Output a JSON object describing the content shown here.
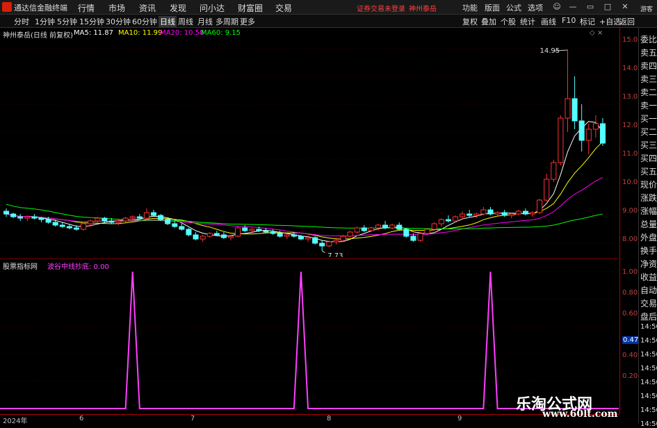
{
  "app": {
    "title": "通达信金融终端"
  },
  "menu": [
    "行情",
    "市场",
    "资讯",
    "发现",
    "问小达",
    "财富圈",
    "交易"
  ],
  "notice": {
    "login": "证券交易未登录",
    "stock": "神州泰岳"
  },
  "top_right": [
    "功能",
    "版面",
    "公式",
    "选项"
  ],
  "periods": [
    "分时",
    "1分钟",
    "5分钟",
    "15分钟",
    "30分钟",
    "60分钟",
    "日线",
    "周线",
    "月线",
    "多周期",
    "更多"
  ],
  "active_period": "日线",
  "tools": [
    "复权",
    "叠加",
    "个股",
    "统计",
    "画线",
    "F10",
    "标记",
    "+自选",
    "返回"
  ],
  "info": {
    "stock_label": "神州泰岳(日线 前复权)",
    "ma5": "MA5: 11.87",
    "ma10": "MA10: 11.99",
    "ma20": "MA20: 10.58",
    "ma60": "MA60: 9.15"
  },
  "annotations": {
    "high": "14.95",
    "low": "7.73"
  },
  "indicator": {
    "name": "股票指标网",
    "line": "波谷中线抄底: 0.00"
  },
  "yaxis_price": [
    "15.00",
    "14.00",
    "13.00",
    "12.00",
    "11.00",
    "10.00",
    "9.00",
    "8.00"
  ],
  "yaxis_ind": [
    "1.00",
    "0.80",
    "0.60",
    "0.47",
    "0.40",
    "0.20"
  ],
  "dates": [
    "2024年",
    "6",
    "7",
    "8",
    "9"
  ],
  "right_panel": [
    "委比",
    "卖五",
    "卖四",
    "卖三",
    "卖二",
    "卖一",
    "买一",
    "买二",
    "买三",
    "买四",
    "买五",
    "现价",
    "涨跌",
    "涨幅",
    "总量",
    "外盘",
    "换手",
    "净资",
    "收益",
    "自动",
    "交易",
    "盘后"
  ],
  "right_times": [
    "14:50",
    "14:50",
    "14:50",
    "14:50",
    "14:50",
    "14:50",
    "14:50",
    "14:50"
  ],
  "watermark": {
    "line1": "乐淘公式网",
    "line2": "www.60lt.com"
  },
  "colors": {
    "ma5": "#ffffff",
    "ma10": "#ffff00",
    "ma20": "#ff00ff",
    "ma60": "#00ff00",
    "up": "#ff3333",
    "down": "#54ffff",
    "ind": "#ff40ff"
  },
  "chart_data": {
    "type": "candlestick",
    "ylim": [
      7.5,
      15.3
    ],
    "ohlc": [
      [
        9.15,
        9.25,
        8.95,
        9.05
      ],
      [
        9.05,
        9.1,
        8.9,
        8.95
      ],
      [
        8.95,
        9.05,
        8.8,
        8.9
      ],
      [
        8.9,
        9.0,
        8.8,
        8.95
      ],
      [
        8.95,
        9.05,
        8.85,
        8.9
      ],
      [
        8.9,
        8.95,
        8.75,
        8.85
      ],
      [
        8.85,
        8.95,
        8.7,
        8.75
      ],
      [
        8.75,
        8.85,
        8.6,
        8.65
      ],
      [
        8.65,
        8.75,
        8.55,
        8.6
      ],
      [
        8.6,
        8.7,
        8.5,
        8.55
      ],
      [
        8.55,
        8.65,
        8.45,
        8.5
      ],
      [
        8.5,
        8.75,
        8.45,
        8.7
      ],
      [
        8.7,
        8.85,
        8.6,
        8.8
      ],
      [
        8.8,
        8.95,
        8.7,
        8.9
      ],
      [
        8.9,
        8.95,
        8.75,
        8.8
      ],
      [
        8.8,
        8.9,
        8.7,
        8.75
      ],
      [
        8.75,
        8.85,
        8.65,
        8.8
      ],
      [
        8.8,
        8.95,
        8.75,
        8.9
      ],
      [
        8.9,
        9.0,
        8.8,
        8.95
      ],
      [
        8.95,
        9.05,
        8.85,
        8.9
      ],
      [
        8.9,
        9.25,
        8.85,
        9.1
      ],
      [
        9.1,
        9.2,
        8.95,
        9.0
      ],
      [
        9.0,
        9.05,
        8.8,
        8.85
      ],
      [
        8.85,
        8.9,
        8.65,
        8.7
      ],
      [
        8.7,
        8.8,
        8.55,
        8.6
      ],
      [
        8.6,
        8.7,
        8.45,
        8.5
      ],
      [
        8.5,
        8.55,
        8.25,
        8.3
      ],
      [
        8.3,
        8.4,
        8.1,
        8.15
      ],
      [
        8.15,
        8.3,
        8.05,
        8.25
      ],
      [
        8.25,
        8.4,
        8.2,
        8.35
      ],
      [
        8.35,
        8.45,
        8.25,
        8.3
      ],
      [
        8.3,
        8.4,
        8.15,
        8.2
      ],
      [
        8.2,
        8.3,
        8.1,
        8.25
      ],
      [
        8.25,
        8.6,
        8.2,
        8.55
      ],
      [
        8.55,
        8.65,
        8.4,
        8.45
      ],
      [
        8.45,
        8.55,
        8.35,
        8.5
      ],
      [
        8.5,
        8.6,
        8.4,
        8.45
      ],
      [
        8.45,
        8.55,
        8.35,
        8.4
      ],
      [
        8.4,
        8.5,
        8.3,
        8.35
      ],
      [
        8.35,
        8.45,
        8.2,
        8.25
      ],
      [
        8.25,
        8.35,
        8.15,
        8.3
      ],
      [
        8.3,
        8.4,
        8.2,
        8.25
      ],
      [
        8.25,
        8.3,
        8.1,
        8.15
      ],
      [
        8.15,
        8.25,
        8.05,
        8.2
      ],
      [
        8.2,
        8.25,
        7.95,
        8.0
      ],
      [
        8.0,
        8.1,
        7.73,
        7.9
      ],
      [
        7.9,
        8.1,
        7.85,
        8.05
      ],
      [
        8.05,
        8.2,
        7.95,
        8.1
      ],
      [
        8.1,
        8.3,
        8.05,
        8.25
      ],
      [
        8.25,
        8.45,
        8.2,
        8.4
      ],
      [
        8.4,
        8.6,
        8.35,
        8.55
      ],
      [
        8.55,
        8.65,
        8.4,
        8.45
      ],
      [
        8.45,
        8.6,
        8.4,
        8.55
      ],
      [
        8.55,
        8.7,
        8.45,
        8.65
      ],
      [
        8.65,
        8.8,
        8.5,
        8.55
      ],
      [
        8.55,
        8.7,
        8.5,
        8.65
      ],
      [
        8.65,
        8.75,
        8.45,
        8.5
      ],
      [
        8.5,
        8.55,
        8.2,
        8.25
      ],
      [
        8.25,
        8.35,
        8.05,
        8.1
      ],
      [
        8.1,
        8.4,
        8.05,
        8.35
      ],
      [
        8.35,
        8.55,
        8.3,
        8.5
      ],
      [
        8.5,
        8.75,
        8.45,
        8.7
      ],
      [
        8.7,
        8.9,
        8.6,
        8.85
      ],
      [
        8.85,
        9.0,
        8.75,
        8.8
      ],
      [
        8.8,
        9.0,
        8.75,
        8.95
      ],
      [
        8.95,
        9.15,
        8.85,
        9.05
      ],
      [
        9.05,
        9.2,
        8.95,
        9.0
      ],
      [
        9.0,
        9.1,
        8.9,
        9.05
      ],
      [
        9.05,
        9.3,
        9.0,
        9.2
      ],
      [
        9.2,
        9.3,
        9.0,
        9.05
      ],
      [
        9.05,
        9.15,
        8.95,
        9.1
      ],
      [
        9.1,
        9.2,
        8.95,
        9.0
      ],
      [
        9.0,
        9.1,
        8.9,
        9.05
      ],
      [
        9.05,
        9.2,
        9.0,
        9.15
      ],
      [
        9.15,
        9.25,
        9.0,
        9.05
      ],
      [
        9.05,
        9.15,
        8.95,
        9.1
      ],
      [
        9.1,
        9.6,
        9.05,
        9.55
      ],
      [
        9.55,
        10.5,
        9.5,
        10.3
      ],
      [
        10.3,
        11.0,
        10.2,
        10.9
      ],
      [
        10.9,
        12.6,
        10.8,
        12.5
      ],
      [
        12.5,
        14.95,
        12.0,
        13.2
      ],
      [
        13.2,
        14.0,
        12.1,
        12.4
      ],
      [
        12.4,
        13.0,
        11.3,
        11.7
      ],
      [
        11.7,
        12.3,
        11.2,
        12.1
      ],
      [
        12.1,
        12.6,
        11.8,
        12.3
      ],
      [
        12.3,
        12.5,
        11.5,
        11.6
      ]
    ],
    "indicator_peaks_index": [
      18,
      42,
      69
    ],
    "indicator_last": 0.0
  }
}
